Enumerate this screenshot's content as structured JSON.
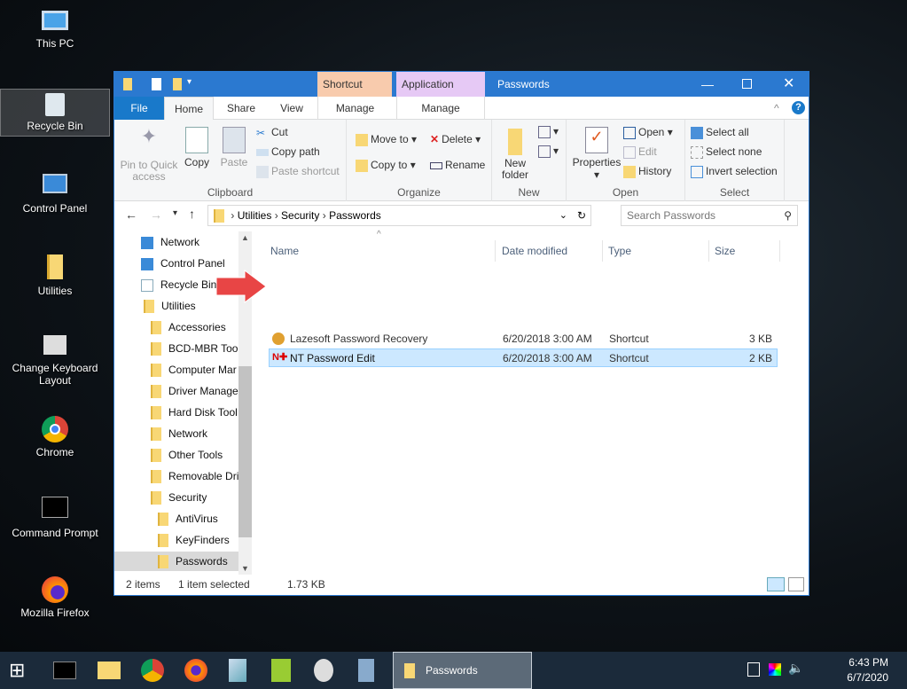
{
  "desktop": {
    "icons": [
      {
        "label": "This PC",
        "icon": "computer-icon"
      },
      {
        "label": "Recycle Bin",
        "icon": "recycle-bin-icon"
      },
      {
        "label": "Control Panel",
        "icon": "control-panel-icon"
      },
      {
        "label": "Utilities",
        "icon": "folder-icon"
      },
      {
        "label": "Change Keyboard Layout",
        "icon": "keyboard-settings-icon"
      },
      {
        "label": "Chrome",
        "icon": "chrome-icon"
      },
      {
        "label": "Command Prompt",
        "icon": "cmd-icon"
      },
      {
        "label": "Mozilla Firefox",
        "icon": "firefox-icon"
      }
    ]
  },
  "window": {
    "title": "Passwords",
    "context_tabs": [
      "Shortcut Tools",
      "Application Tools"
    ],
    "tabs": [
      "File",
      "Home",
      "Share",
      "View",
      "Manage",
      "Manage"
    ],
    "ribbon": {
      "clipboard": {
        "label": "Clipboard",
        "pin": "Pin to Quick access",
        "copy": "Copy",
        "paste": "Paste",
        "cut": "Cut",
        "copy_path": "Copy path",
        "paste_shortcut": "Paste shortcut"
      },
      "organize": {
        "label": "Organize",
        "move_to": "Move to",
        "copy_to": "Copy to",
        "delete": "Delete",
        "rename": "Rename"
      },
      "new": {
        "label": "New",
        "new_folder": "New folder"
      },
      "open": {
        "label": "Open",
        "properties": "Properties",
        "open": "Open",
        "edit": "Edit",
        "history": "History"
      },
      "select": {
        "label": "Select",
        "select_all": "Select all",
        "select_none": "Select none",
        "invert": "Invert selection"
      }
    },
    "breadcrumb": [
      "Utilities",
      "Security",
      "Passwords"
    ],
    "search_placeholder": "Search Passwords",
    "nav": [
      "Network",
      "Control Panel",
      "Recycle Bin",
      "Utilities",
      "Accessories",
      "BCD-MBR Tool",
      "Computer Mar",
      "Driver Manage",
      "Hard Disk Tool",
      "Network",
      "Other Tools",
      "Removable Dri",
      "Security",
      "AntiVirus",
      "KeyFinders",
      "Passwords"
    ],
    "columns": [
      "Name",
      "Date modified",
      "Type",
      "Size"
    ],
    "files": [
      {
        "name": "Lazesoft Password Recovery",
        "date": "6/20/2018 3:00 AM",
        "type": "Shortcut",
        "size": "3 KB"
      },
      {
        "name": "NT Password Edit",
        "date": "6/20/2018 3:00 AM",
        "type": "Shortcut",
        "size": "2 KB"
      }
    ],
    "status": {
      "count": "2 items",
      "selected": "1 item selected",
      "size": "1.73 KB"
    }
  },
  "taskbar": {
    "active": "Passwords",
    "time": "6:43 PM",
    "date": "6/7/2020"
  },
  "colors": {
    "accent": "#2b79d0",
    "shortcut_tools": "#f8cbad",
    "application_tools": "#e6c9f5",
    "selection": "#cce8ff",
    "arrow": "#e84545"
  }
}
